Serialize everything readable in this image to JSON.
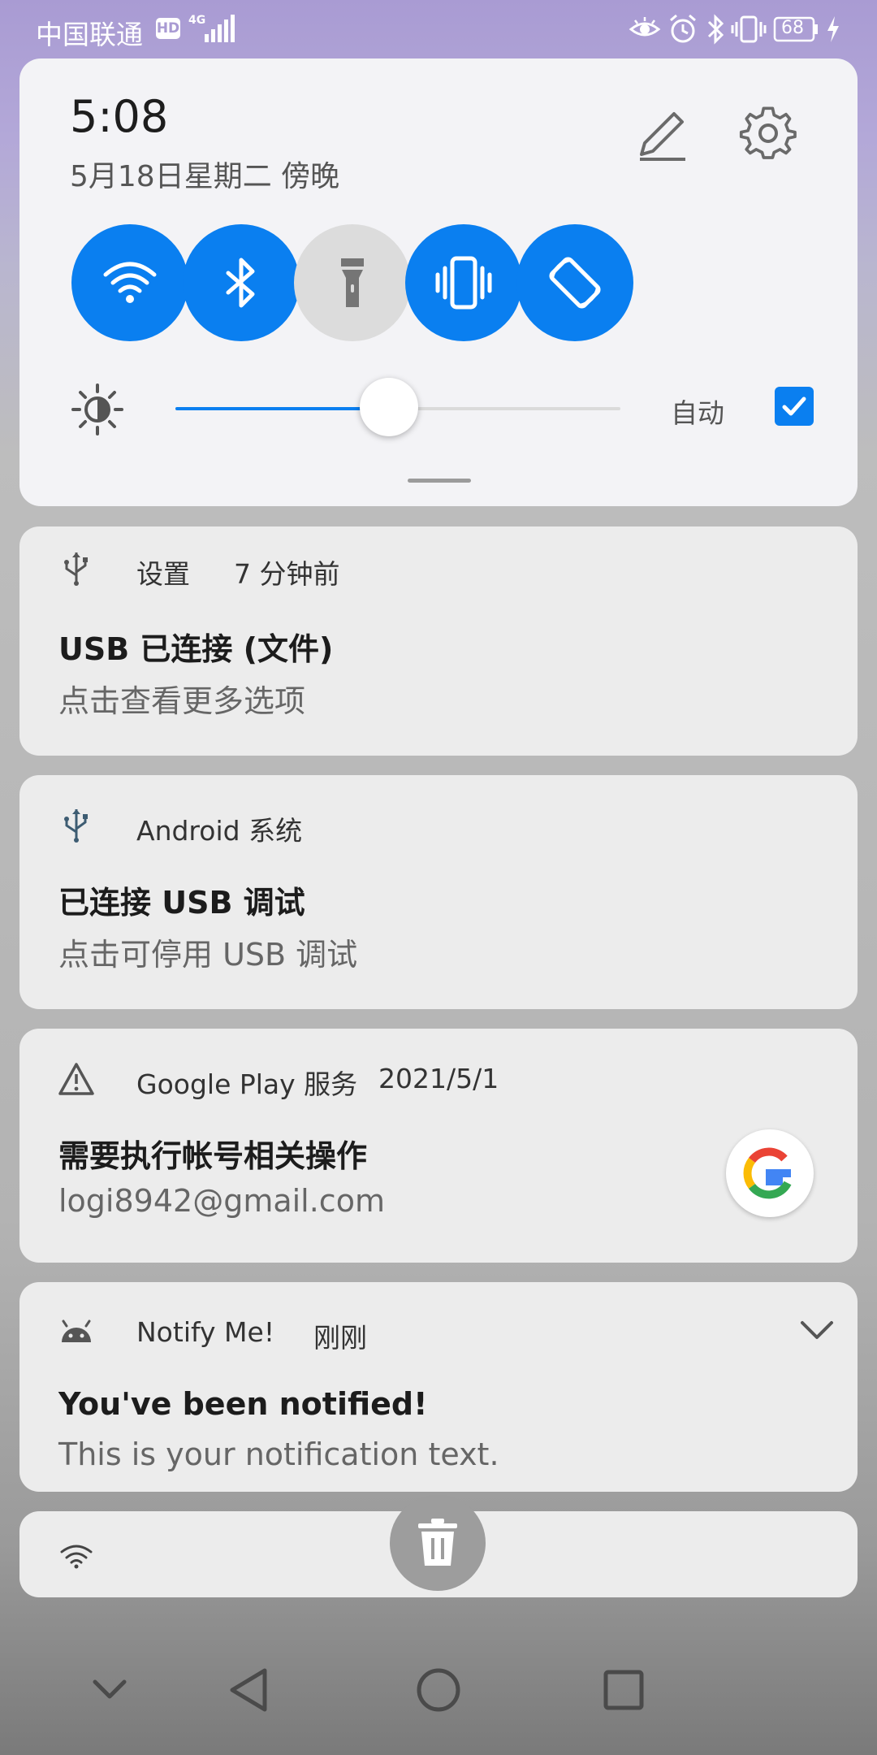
{
  "status_bar": {
    "carrier": "中国联通",
    "hd_badge": "HD",
    "network_type": "4G",
    "battery_level": "68",
    "icons": [
      "hd-badge",
      "signal-icon",
      "eye-icon",
      "alarm-icon",
      "bluetooth-icon",
      "vibrate-icon",
      "battery-icon",
      "charging-icon"
    ]
  },
  "quick_settings": {
    "time": "5:08",
    "date": "5月18日星期二 傍晚",
    "tiles": [
      {
        "name": "wifi",
        "icon": "wifi-icon",
        "enabled": true
      },
      {
        "name": "bluetooth",
        "icon": "bluetooth-icon",
        "enabled": true
      },
      {
        "name": "flashlight",
        "icon": "flashlight-icon",
        "enabled": false
      },
      {
        "name": "vibrate",
        "icon": "vibrate-icon",
        "enabled": true
      },
      {
        "name": "auto-rotate",
        "icon": "rotate-icon",
        "enabled": true
      }
    ],
    "brightness": {
      "level_fraction": 0.48,
      "auto_label": "自动",
      "auto_checked": true
    },
    "accent_color": "#0a7ff0"
  },
  "notifications": [
    {
      "icon": "usb-icon",
      "app": "设置",
      "time": "7 分钟前",
      "title": "USB 已连接 (文件)",
      "text": "点击查看更多选项"
    },
    {
      "icon": "usb-icon",
      "app": "Android 系统",
      "time": "",
      "title": "已连接 USB 调试",
      "text": "点击可停用 USB 调试"
    },
    {
      "icon": "warning-icon",
      "app": "Google Play 服务",
      "time": "2021/5/1",
      "title": "需要执行帐号相关操作",
      "text": "logi8942@gmail.com",
      "avatar": "google-logo-icon"
    },
    {
      "icon": "android-icon",
      "app": "Notify Me!",
      "time": "刚刚",
      "title": "You've been notified!",
      "text": "This is your notification text.",
      "expand": "chevron-down-icon"
    }
  ],
  "collapsed_notification": {
    "icon": "wifi-question-icon"
  },
  "clear_all": {
    "icon": "trash-icon"
  },
  "nav_bar": {
    "buttons": [
      "chevron-down-icon",
      "back-icon",
      "home-icon",
      "recents-icon"
    ]
  }
}
